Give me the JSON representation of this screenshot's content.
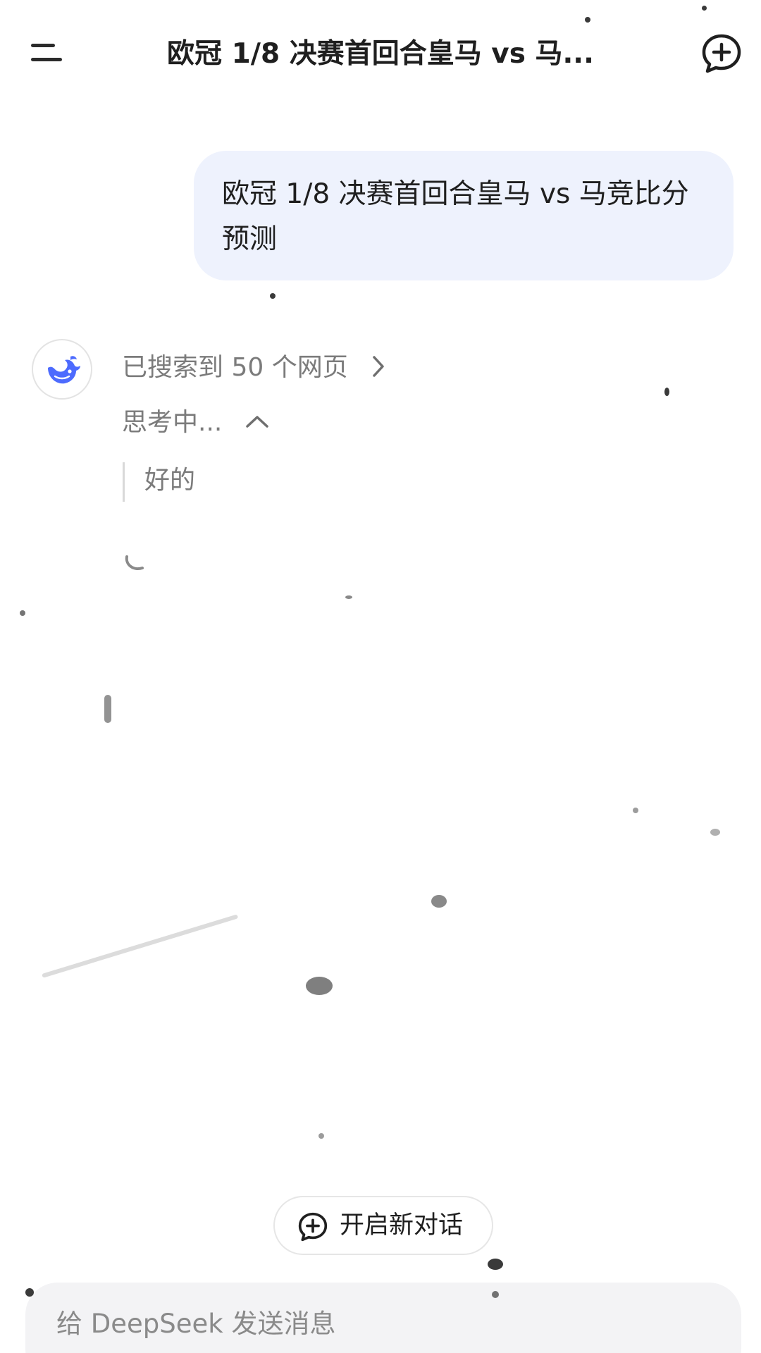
{
  "header": {
    "title": "欧冠 1/8 决赛首回合皇马 vs 马...",
    "menu_icon": "menu-icon",
    "new_chat_icon": "chat-plus-icon"
  },
  "conversation": {
    "user_message": "欧冠 1/8 决赛首回合皇马 vs 马竞比分预测",
    "assistant": {
      "avatar_icon": "deepseek-whale-icon",
      "search_summary": "已搜索到 50 个网页",
      "thinking_label": "思考中...",
      "thinking_text": "好的"
    }
  },
  "new_chat_button": {
    "label": "开启新对话"
  },
  "composer": {
    "placeholder": "给 DeepSeek 发送消息"
  },
  "colors": {
    "user_bubble_bg": "#eef2fd",
    "brand_blue": "#4d6bfe",
    "muted_text": "#7b7b7b"
  }
}
